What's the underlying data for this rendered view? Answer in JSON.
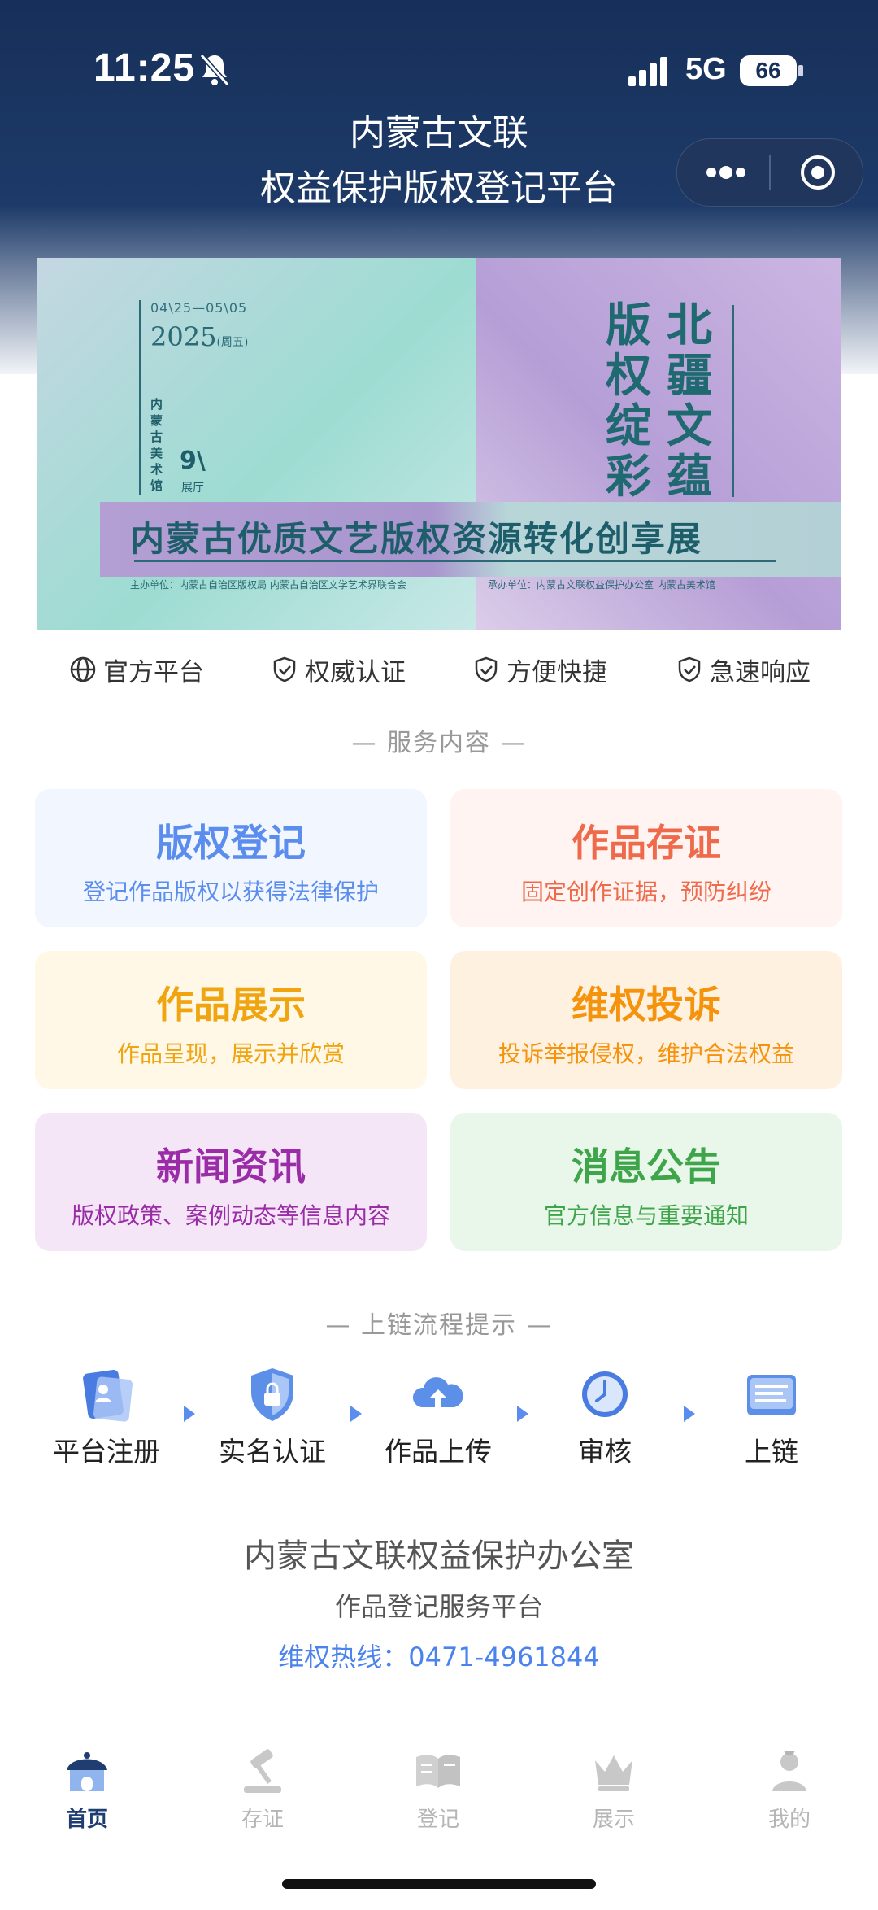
{
  "status": {
    "time": "11:25",
    "network": "5G",
    "battery": "66"
  },
  "app": {
    "title_line1": "内蒙古文联",
    "title_line2": "权益保护版权登记平台"
  },
  "banner": {
    "date": "04\\25—05\\05",
    "year": "2025",
    "year_note": "(周五)",
    "museum": "内蒙古美术馆",
    "hall": "9\\",
    "hall_sub": "展厅",
    "vertical_1": "北疆文蕴",
    "vertical_2": "版权绽彩",
    "main_title": "内蒙古优质文艺版权资源转化创享展",
    "host": "主办单位：内蒙古自治区版权局  内蒙古自治区文学艺术界联合会",
    "organizer": "承办单位：内蒙古文联权益保护办公室  内蒙古美术馆"
  },
  "features": [
    "官方平台",
    "权威认证",
    "方便快捷",
    "急速响应"
  ],
  "services_title": "— 服务内容 —",
  "services": [
    {
      "title": "版权登记",
      "subtitle": "登记作品版权以获得法律保护"
    },
    {
      "title": "作品存证",
      "subtitle": "固定创作证据，预防纠纷"
    },
    {
      "title": "作品展示",
      "subtitle": "作品呈现，展示并欣赏"
    },
    {
      "title": "维权投诉",
      "subtitle": "投诉举报侵权，维护合法权益"
    },
    {
      "title": "新闻资讯",
      "subtitle": "版权政策、案例动态等信息内容"
    },
    {
      "title": "消息公告",
      "subtitle": "官方信息与重要通知"
    }
  ],
  "process_title": "— 上链流程提示 —",
  "process_steps": [
    "平台注册",
    "实名认证",
    "作品上传",
    "审核",
    "上链"
  ],
  "footer": {
    "office": "内蒙古文联权益保护办公室",
    "platform": "作品登记服务平台",
    "hotline": "维权热线：0471-4961844"
  },
  "tabs": [
    "首页",
    "存证",
    "登记",
    "展示",
    "我的"
  ],
  "colors": {
    "accent": "#4a82ee",
    "header_bg": "#17305a",
    "card_blue": "#f1f6ff",
    "card_red": "#fff4f1",
    "card_yellow": "#fff8e6",
    "card_orange": "#fff1e0",
    "card_purple": "#f5e6f7",
    "card_green": "#e9f6ea"
  }
}
